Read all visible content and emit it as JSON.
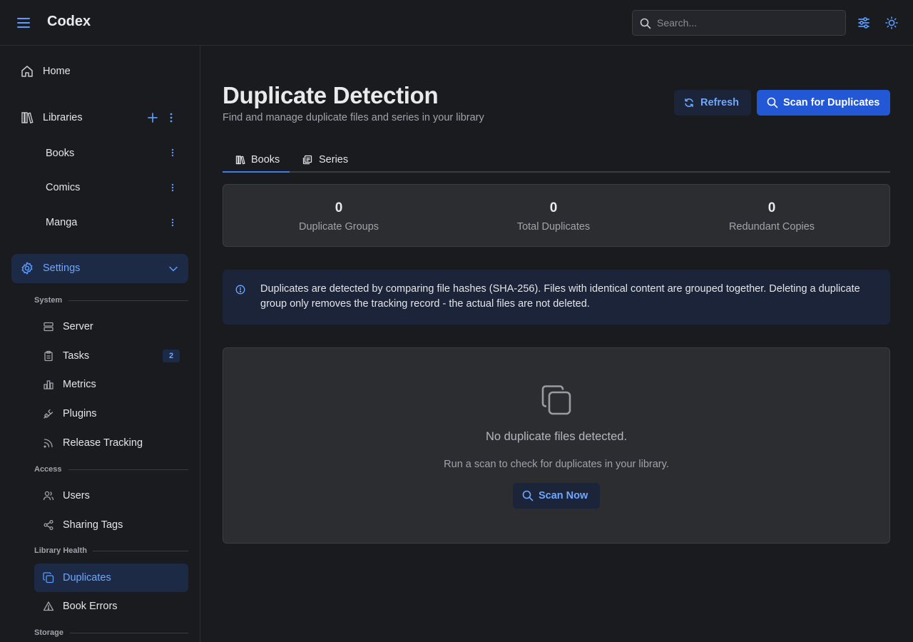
{
  "app": {
    "title": "Codex"
  },
  "header": {
    "search_placeholder": "Search...",
    "icons": [
      "menu-icon",
      "search-icon",
      "sliders-icon",
      "sun-icon"
    ]
  },
  "sidebar": {
    "home": "Home",
    "libraries": {
      "label": "Libraries",
      "items": [
        "Books",
        "Comics",
        "Manga"
      ]
    },
    "settings": {
      "label": "Settings",
      "sections": {
        "system": {
          "label": "System",
          "items": [
            {
              "label": "Server",
              "icon": "server-icon"
            },
            {
              "label": "Tasks",
              "icon": "clipboard-icon",
              "badge": "2"
            },
            {
              "label": "Metrics",
              "icon": "bar-chart-icon"
            },
            {
              "label": "Plugins",
              "icon": "plug-icon"
            },
            {
              "label": "Release Tracking",
              "icon": "rss-icon"
            }
          ]
        },
        "access": {
          "label": "Access",
          "items": [
            {
              "label": "Users",
              "icon": "users-icon"
            },
            {
              "label": "Sharing Tags",
              "icon": "share-icon"
            }
          ]
        },
        "library_health": {
          "label": "Library Health",
          "items": [
            {
              "label": "Duplicates",
              "icon": "copy-icon",
              "active": true
            },
            {
              "label": "Book Errors",
              "icon": "warning-icon"
            }
          ]
        },
        "storage": {
          "label": "Storage"
        }
      }
    }
  },
  "main": {
    "title": "Duplicate Detection",
    "subtitle": "Find and manage duplicate files and series in your library",
    "actions": {
      "refresh": "Refresh",
      "scan": "Scan for Duplicates"
    },
    "tabs": [
      {
        "label": "Books",
        "icon": "books-icon",
        "active": true
      },
      {
        "label": "Series",
        "icon": "series-icon",
        "active": false
      }
    ],
    "stats": [
      {
        "value": "0",
        "label": "Duplicate Groups"
      },
      {
        "value": "0",
        "label": "Total Duplicates"
      },
      {
        "value": "0",
        "label": "Redundant Copies"
      }
    ],
    "info": "Duplicates are detected by comparing file hashes (SHA-256). Files with identical content are grouped together. Deleting a duplicate group only removes the tracking record - the actual files are not deleted.",
    "empty": {
      "title": "No duplicate files detected.",
      "subtitle": "Run a scan to check for duplicates in your library.",
      "button": "Scan Now"
    }
  },
  "colors": {
    "accent": "#3d7bf0",
    "primary_button": "#2257d6",
    "active_bg": "#1c2a46",
    "link_text": "#6ea7ff"
  }
}
